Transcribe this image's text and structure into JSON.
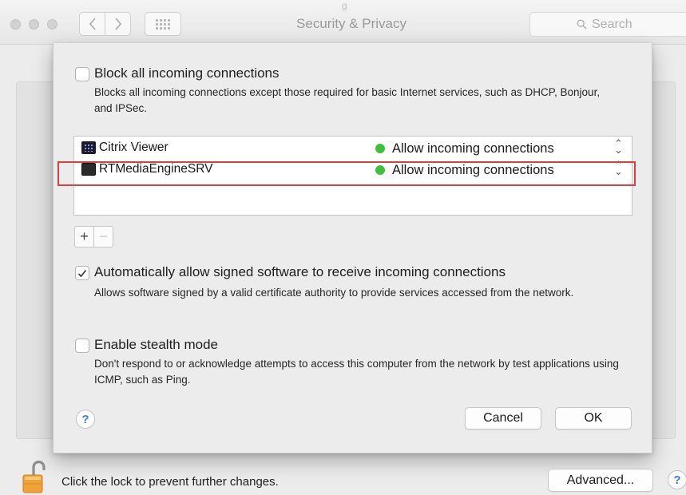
{
  "window": {
    "title": "Security & Privacy",
    "title_fragment": "g",
    "search_placeholder": "Search"
  },
  "sheet": {
    "block_all": {
      "label": "Block all incoming connections",
      "checked": false,
      "description": "Blocks all incoming connections except those required for basic Internet services,  such as DHCP, Bonjour, and IPSec."
    },
    "apps": [
      {
        "name": "Citrix Viewer",
        "icon": "citrix-app-icon",
        "status_color": "#3ec03a",
        "policy": "Allow incoming connections",
        "highlighted": false
      },
      {
        "name": "RTMediaEngineSRV",
        "icon": "terminal-app-icon",
        "status_color": "#3ec03a",
        "policy": "Allow incoming connections",
        "highlighted": true
      }
    ],
    "add_label": "+",
    "remove_label": "−",
    "auto_allow": {
      "label": "Automatically allow signed software to receive incoming connections",
      "checked": true,
      "description": "Allows software signed by a valid certificate authority to provide services accessed from the network."
    },
    "stealth": {
      "label": "Enable stealth mode",
      "checked": false,
      "description": "Don't respond to or acknowledge attempts to access this computer from the network by test applications using ICMP, such as Ping."
    },
    "help_label": "?",
    "cancel_label": "Cancel",
    "ok_label": "OK"
  },
  "footer": {
    "lock_text": "Click the lock to prevent further changes.",
    "advanced_label": "Advanced...",
    "help_label": "?"
  },
  "colors": {
    "status_green": "#3ec03a",
    "highlight_red": "#d94141",
    "help_blue": "#3a7ae8",
    "lock_orange": "#f0a23a"
  }
}
